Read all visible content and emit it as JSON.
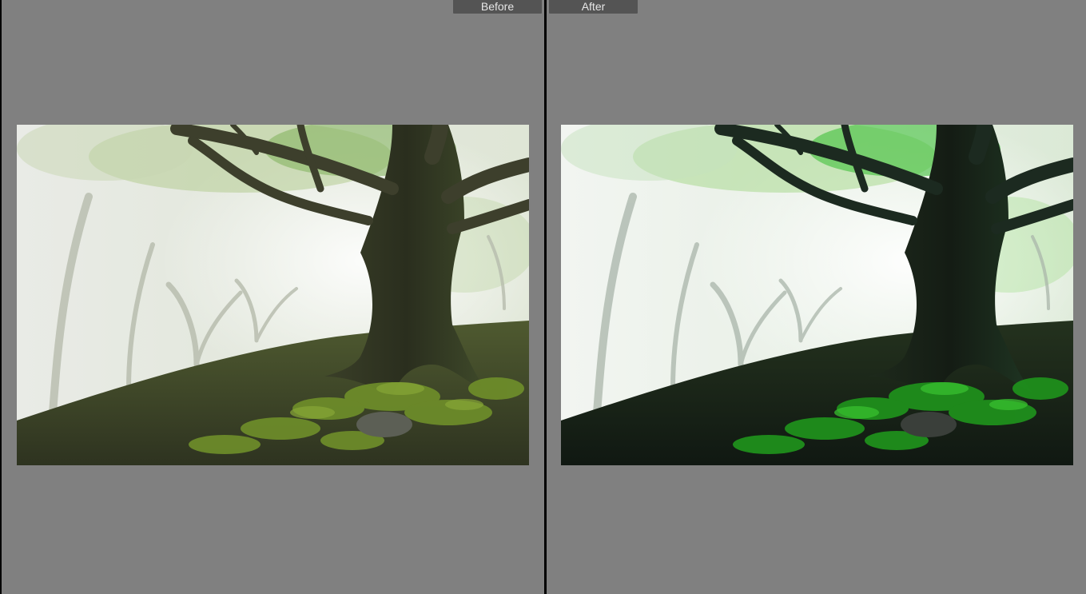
{
  "compare_view": {
    "before": {
      "label": "Before",
      "image": "misty-forest-old-tree-photo"
    },
    "after": {
      "label": "After",
      "image": "misty-forest-old-tree-photo-edited"
    }
  },
  "colors": {
    "pane_background": "#808080",
    "divider": "#000000",
    "label_tab": "#545454",
    "label_text": "#e6e6e6"
  }
}
